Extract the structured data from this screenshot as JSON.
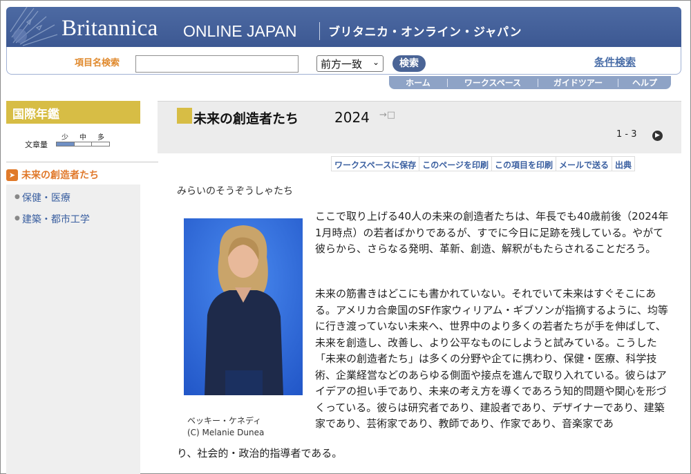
{
  "header": {
    "brand": "Britannica",
    "brand_sub": "ONLINE JAPAN",
    "brand_jp": "ブリタニカ・オンライン・ジャパン"
  },
  "search": {
    "label": "項目名検索",
    "input_value": "",
    "mode_selected": "前方一致",
    "button": "検索",
    "advanced": "条件検索"
  },
  "nav": {
    "tabs": [
      "ホーム",
      "ワークスペース",
      "ガイドツアー",
      "ヘルプ"
    ]
  },
  "sidebar": {
    "title": "国際年鑑",
    "volume_label": "文章量",
    "volume_levels": [
      "少",
      "中",
      "多"
    ],
    "volume_selected": "少",
    "current": "未来の創造者たち",
    "items": [
      "保健・医療",
      "建築・都市工学"
    ]
  },
  "article": {
    "title": "未来の創造者たち",
    "year": "2024",
    "pagination": "1 - 3",
    "actions": [
      "ワークスペースに保存",
      "このページを印刷",
      "この項目を印刷",
      "メールで送る",
      "出典"
    ],
    "reading": "みらいのそうぞうしゃたち",
    "photo_caption": "ベッキー・ケネディ",
    "photo_credit": "(C) Melanie Dunea",
    "paragraph1": "ここで取り上げる40人の未来の創造者たちは、年長でも40歳前後（2024年1月時点）の若者ばかりであるが、すでに今日に足跡を残している。やがて彼らから、さらなる発明、革新、創造、解釈がもたらされることだろう。",
    "paragraph2": "未来の筋書きはどこにも書かれていない。それでいて未来はすぐそこにある。アメリカ合衆国のSF作家ウィリアム・ギブソンが指摘するように、均等に行き渡っていない未来へ、世界中のより多くの若者たちが手を伸ばして、未来を創造し、改善し、より公平なものにしようと試みている。こうした「未来の創造者たち」は多くの分野や企てに携わり、保健・医療、科学技術、企業経営などのあらゆる側面や接点を進んで取り入れている。彼らはアイデアの担い手であり、未来の考え方を導くであろう知的問題や関心を形づくっている。彼らは研究者であり、建設者であり、デザイナーであり、建築家であり、芸術家であり、教師であり、作家であり、音楽家であ",
    "paragraph3": "り、社会的・政治的指導者である。"
  },
  "colors": {
    "banner": "#3c5892",
    "gold": "#d7bd45",
    "link": "#3a5fa0",
    "orange": "#e07a2a"
  }
}
